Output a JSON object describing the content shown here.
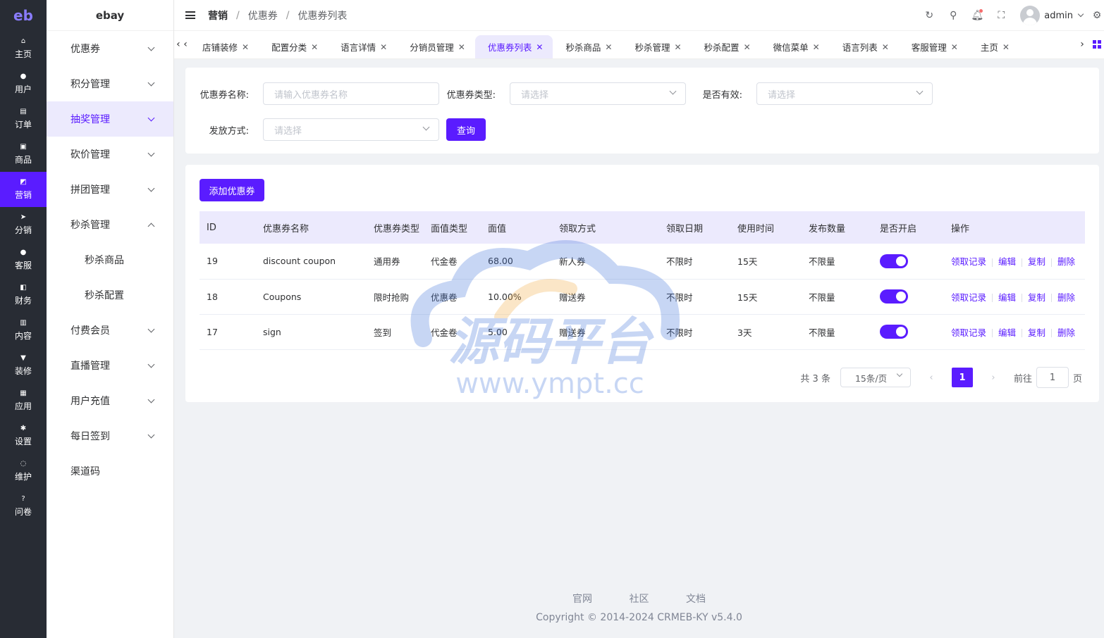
{
  "rail": {
    "logo": "eb",
    "items": [
      {
        "label": "主页",
        "icon": "home-icon"
      },
      {
        "label": "用户",
        "icon": "user-icon"
      },
      {
        "label": "订单",
        "icon": "order-icon"
      },
      {
        "label": "商品",
        "icon": "goods-icon"
      },
      {
        "label": "营销",
        "icon": "marketing-icon"
      },
      {
        "label": "分销",
        "icon": "distribution-icon"
      },
      {
        "label": "客服",
        "icon": "service-icon"
      },
      {
        "label": "财务",
        "icon": "finance-icon"
      },
      {
        "label": "内容",
        "icon": "content-icon"
      },
      {
        "label": "装修",
        "icon": "decorate-icon"
      },
      {
        "label": "应用",
        "icon": "apps-icon"
      },
      {
        "label": "设置",
        "icon": "settings-icon"
      },
      {
        "label": "维护",
        "icon": "maintenance-icon"
      },
      {
        "label": "问卷",
        "icon": "survey-icon"
      }
    ]
  },
  "menu": {
    "brand": "ebay",
    "items": [
      {
        "label": "优惠券"
      },
      {
        "label": "积分管理"
      },
      {
        "label": "抽奖管理"
      },
      {
        "label": "砍价管理"
      },
      {
        "label": "拼团管理"
      },
      {
        "label": "秒杀管理"
      },
      {
        "label": "秒杀商品"
      },
      {
        "label": "秒杀配置"
      },
      {
        "label": "付费会员"
      },
      {
        "label": "直播管理"
      },
      {
        "label": "用户充值"
      },
      {
        "label": "每日签到"
      },
      {
        "label": "渠道码"
      }
    ]
  },
  "breadcrumb": {
    "root": "营销",
    "mid": "优惠券",
    "current": "优惠券列表"
  },
  "user": {
    "name": "admin"
  },
  "tabs": [
    {
      "label": "店铺装修"
    },
    {
      "label": "配置分类"
    },
    {
      "label": "语言详情"
    },
    {
      "label": "分销员管理"
    },
    {
      "label": "优惠券列表"
    },
    {
      "label": "秒杀商品"
    },
    {
      "label": "秒杀管理"
    },
    {
      "label": "秒杀配置"
    },
    {
      "label": "微信菜单"
    },
    {
      "label": "语言列表"
    },
    {
      "label": "客服管理"
    },
    {
      "label": "主页"
    }
  ],
  "filter": {
    "name_label": "优惠券名称:",
    "name_placeholder": "请输入优惠券名称",
    "type_label": "优惠券类型:",
    "type_placeholder": "请选择",
    "valid_label": "是否有效:",
    "valid_placeholder": "请选择",
    "issue_label": "发放方式:",
    "issue_placeholder": "请选择",
    "query_button": "查询"
  },
  "list": {
    "add_button": "添加优惠券",
    "columns": [
      "ID",
      "优惠券名称",
      "优惠券类型",
      "面值类型",
      "面值",
      "领取方式",
      "领取日期",
      "使用时间",
      "发布数量",
      "是否开启",
      "操作"
    ],
    "rows": [
      {
        "id": "19",
        "name": "discount coupon",
        "type": "通用券",
        "value_type": "代金卷",
        "value": "68.00",
        "receive": "新人券",
        "date": "不限时",
        "use_time": "15天",
        "count": "不限量",
        "enabled": true
      },
      {
        "id": "18",
        "name": "Coupons",
        "type": "限时抢购",
        "value_type": "优惠卷",
        "value": "10.00%",
        "receive": "赠送券",
        "date": "不限时",
        "use_time": "15天",
        "count": "不限量",
        "enabled": true
      },
      {
        "id": "17",
        "name": "sign",
        "type": "签到",
        "value_type": "代金卷",
        "value": "5.00",
        "receive": "赠送券",
        "date": "不限时",
        "use_time": "3天",
        "count": "不限量",
        "enabled": true
      }
    ],
    "ops": {
      "records": "领取记录",
      "edit": "编辑",
      "copy": "复制",
      "delete": "删除"
    }
  },
  "pager": {
    "total": "共 3 条",
    "size": "15条/页",
    "current": "1",
    "goto_prefix": "前往",
    "goto_value": "1",
    "goto_suffix": "页"
  },
  "footer": {
    "links": [
      "官网",
      "社区",
      "文档"
    ],
    "copyright": "Copyright © 2014-2024 CRMEB-KY v5.4.0"
  },
  "watermark": {
    "text": "源码平台",
    "url": "www.ympt.cc"
  },
  "colors": {
    "accent": "#5a1cff",
    "rail_bg": "#282c34",
    "header_row": "#eceafd"
  }
}
